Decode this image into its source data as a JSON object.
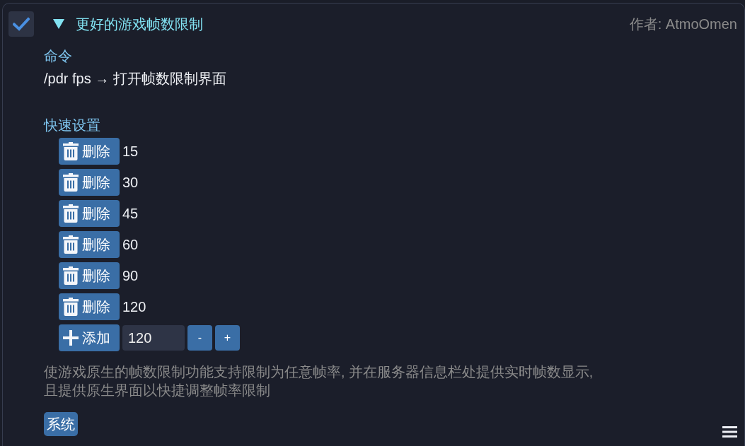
{
  "plugin": {
    "enabled": true,
    "expanded": true,
    "title": "更好的游戏帧数限制",
    "author": "作者: AtmoOmen"
  },
  "command_section": {
    "heading": "命令",
    "command": "/pdr fps → 打开帧数限制界面"
  },
  "quick_settings": {
    "heading": "快速设置",
    "presets": [
      {
        "button": "删除",
        "value": "15"
      },
      {
        "button": "删除",
        "value": "30"
      },
      {
        "button": "删除",
        "value": "45"
      },
      {
        "button": "删除",
        "value": "60"
      },
      {
        "button": "删除",
        "value": "90"
      },
      {
        "button": "删除",
        "value": "120"
      }
    ],
    "add_row": {
      "button": "添加",
      "value": "120",
      "decrement": "-",
      "increment": "+"
    }
  },
  "description": "使游戏原生的帧数限制功能支持限制为任意帧率, 并在服务器信息栏处提供实时帧数显示,\n且提供原生界面以快捷调整帧率限制",
  "tags": [
    "系统"
  ]
}
